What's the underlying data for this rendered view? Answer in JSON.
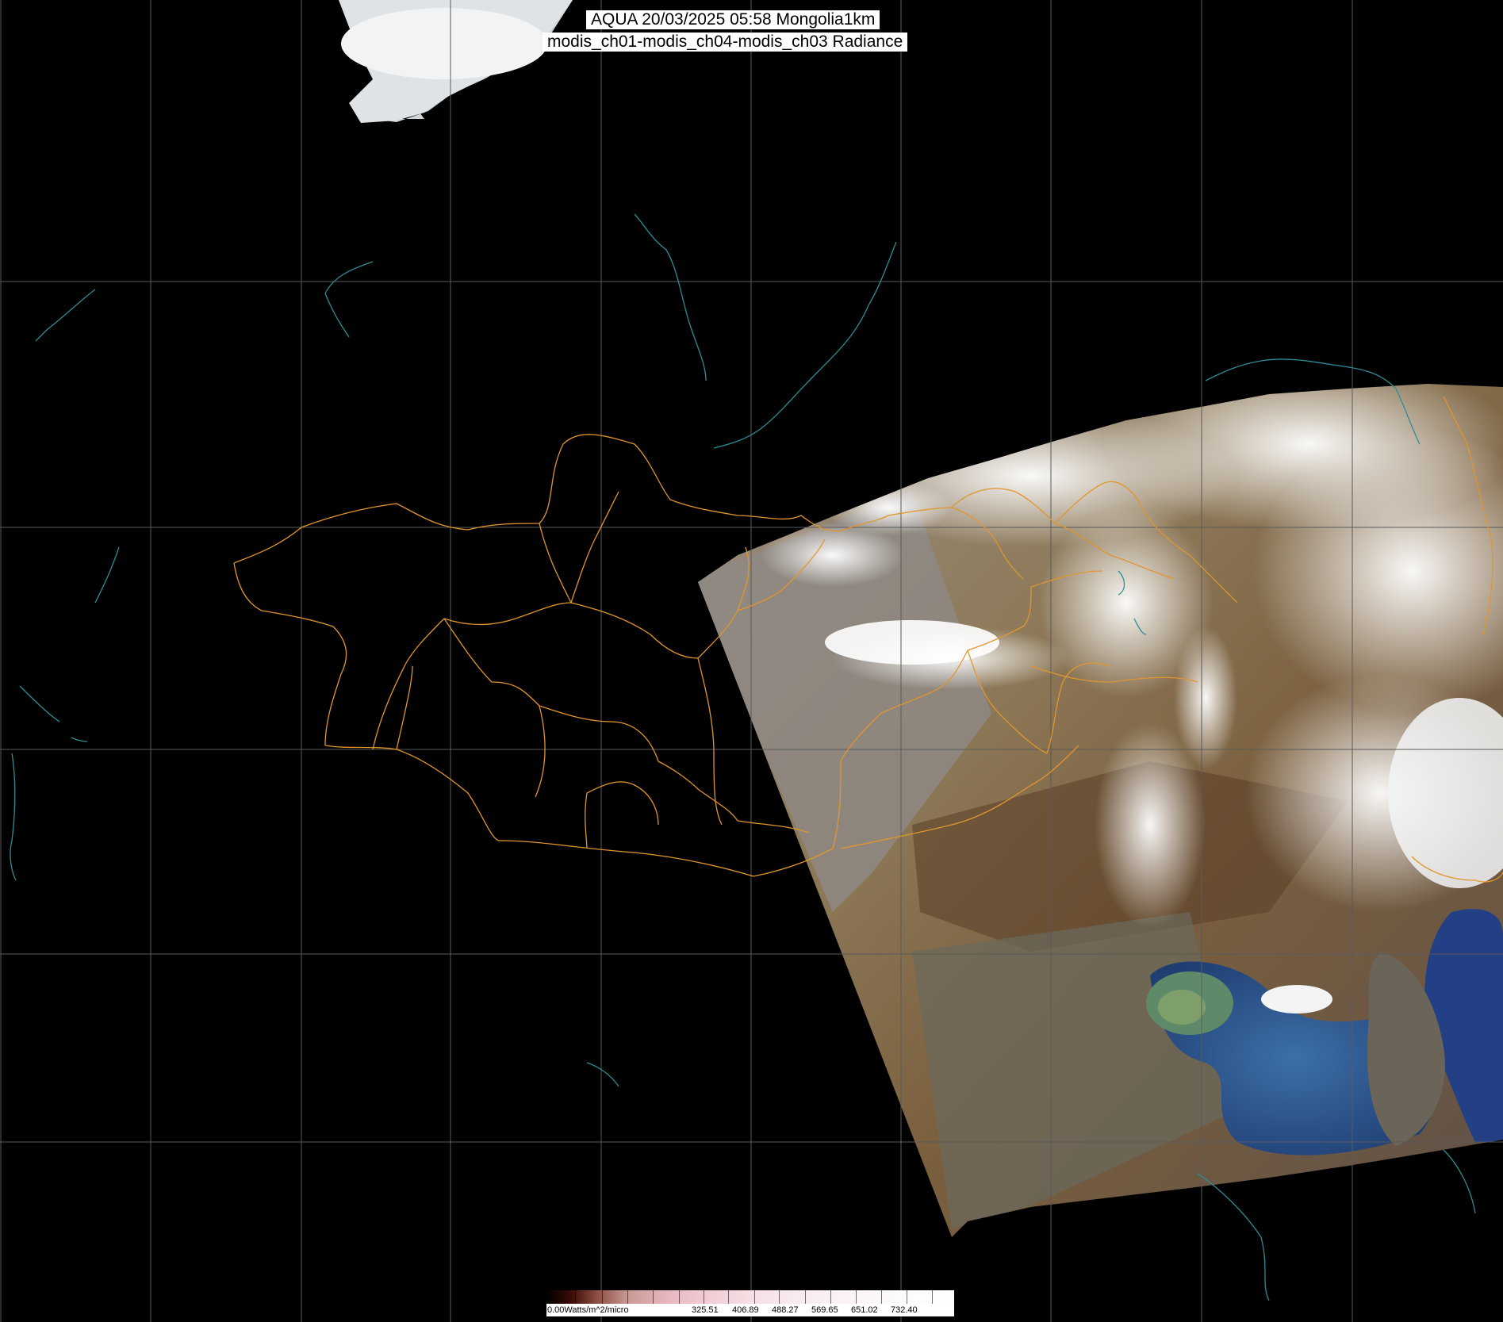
{
  "title": {
    "line1": "AQUA 20/03/2025 05:58 Mongolia1km",
    "line2": "modis_ch01-modis_ch04-modis_ch03 Radiance"
  },
  "legend": {
    "min_label": "0.00Watts/m^2/micro",
    "values": [
      "325.51",
      "406.89",
      "488.27",
      "569.65",
      "651.02",
      "732.40"
    ]
  },
  "colors": {
    "background": "#000000",
    "grid": "#5a5a5a",
    "border": "#e0962e",
    "coast": "#2f8c94",
    "cloud": "#eef0f2",
    "land": "#8a7654",
    "sea": "#2c5a8c"
  }
}
